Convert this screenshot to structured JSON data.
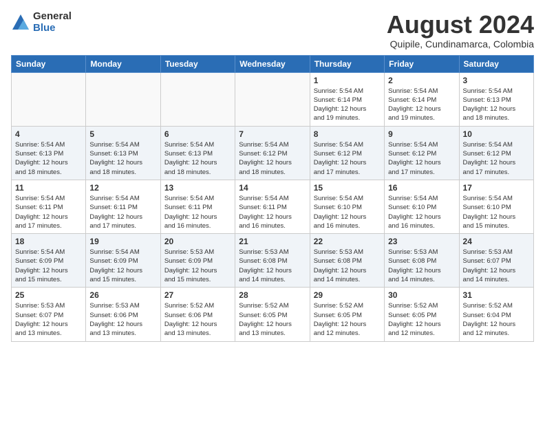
{
  "logo": {
    "general": "General",
    "blue": "Blue"
  },
  "title": "August 2024",
  "location": "Quipile, Cundinamarca, Colombia",
  "weekdays": [
    "Sunday",
    "Monday",
    "Tuesday",
    "Wednesday",
    "Thursday",
    "Friday",
    "Saturday"
  ],
  "weeks": [
    [
      {
        "day": "",
        "info": ""
      },
      {
        "day": "",
        "info": ""
      },
      {
        "day": "",
        "info": ""
      },
      {
        "day": "",
        "info": ""
      },
      {
        "day": "1",
        "info": "Sunrise: 5:54 AM\nSunset: 6:14 PM\nDaylight: 12 hours\nand 19 minutes."
      },
      {
        "day": "2",
        "info": "Sunrise: 5:54 AM\nSunset: 6:14 PM\nDaylight: 12 hours\nand 19 minutes."
      },
      {
        "day": "3",
        "info": "Sunrise: 5:54 AM\nSunset: 6:13 PM\nDaylight: 12 hours\nand 18 minutes."
      }
    ],
    [
      {
        "day": "4",
        "info": "Sunrise: 5:54 AM\nSunset: 6:13 PM\nDaylight: 12 hours\nand 18 minutes."
      },
      {
        "day": "5",
        "info": "Sunrise: 5:54 AM\nSunset: 6:13 PM\nDaylight: 12 hours\nand 18 minutes."
      },
      {
        "day": "6",
        "info": "Sunrise: 5:54 AM\nSunset: 6:13 PM\nDaylight: 12 hours\nand 18 minutes."
      },
      {
        "day": "7",
        "info": "Sunrise: 5:54 AM\nSunset: 6:12 PM\nDaylight: 12 hours\nand 18 minutes."
      },
      {
        "day": "8",
        "info": "Sunrise: 5:54 AM\nSunset: 6:12 PM\nDaylight: 12 hours\nand 17 minutes."
      },
      {
        "day": "9",
        "info": "Sunrise: 5:54 AM\nSunset: 6:12 PM\nDaylight: 12 hours\nand 17 minutes."
      },
      {
        "day": "10",
        "info": "Sunrise: 5:54 AM\nSunset: 6:12 PM\nDaylight: 12 hours\nand 17 minutes."
      }
    ],
    [
      {
        "day": "11",
        "info": "Sunrise: 5:54 AM\nSunset: 6:11 PM\nDaylight: 12 hours\nand 17 minutes."
      },
      {
        "day": "12",
        "info": "Sunrise: 5:54 AM\nSunset: 6:11 PM\nDaylight: 12 hours\nand 17 minutes."
      },
      {
        "day": "13",
        "info": "Sunrise: 5:54 AM\nSunset: 6:11 PM\nDaylight: 12 hours\nand 16 minutes."
      },
      {
        "day": "14",
        "info": "Sunrise: 5:54 AM\nSunset: 6:11 PM\nDaylight: 12 hours\nand 16 minutes."
      },
      {
        "day": "15",
        "info": "Sunrise: 5:54 AM\nSunset: 6:10 PM\nDaylight: 12 hours\nand 16 minutes."
      },
      {
        "day": "16",
        "info": "Sunrise: 5:54 AM\nSunset: 6:10 PM\nDaylight: 12 hours\nand 16 minutes."
      },
      {
        "day": "17",
        "info": "Sunrise: 5:54 AM\nSunset: 6:10 PM\nDaylight: 12 hours\nand 15 minutes."
      }
    ],
    [
      {
        "day": "18",
        "info": "Sunrise: 5:54 AM\nSunset: 6:09 PM\nDaylight: 12 hours\nand 15 minutes."
      },
      {
        "day": "19",
        "info": "Sunrise: 5:54 AM\nSunset: 6:09 PM\nDaylight: 12 hours\nand 15 minutes."
      },
      {
        "day": "20",
        "info": "Sunrise: 5:53 AM\nSunset: 6:09 PM\nDaylight: 12 hours\nand 15 minutes."
      },
      {
        "day": "21",
        "info": "Sunrise: 5:53 AM\nSunset: 6:08 PM\nDaylight: 12 hours\nand 14 minutes."
      },
      {
        "day": "22",
        "info": "Sunrise: 5:53 AM\nSunset: 6:08 PM\nDaylight: 12 hours\nand 14 minutes."
      },
      {
        "day": "23",
        "info": "Sunrise: 5:53 AM\nSunset: 6:08 PM\nDaylight: 12 hours\nand 14 minutes."
      },
      {
        "day": "24",
        "info": "Sunrise: 5:53 AM\nSunset: 6:07 PM\nDaylight: 12 hours\nand 14 minutes."
      }
    ],
    [
      {
        "day": "25",
        "info": "Sunrise: 5:53 AM\nSunset: 6:07 PM\nDaylight: 12 hours\nand 13 minutes."
      },
      {
        "day": "26",
        "info": "Sunrise: 5:53 AM\nSunset: 6:06 PM\nDaylight: 12 hours\nand 13 minutes."
      },
      {
        "day": "27",
        "info": "Sunrise: 5:52 AM\nSunset: 6:06 PM\nDaylight: 12 hours\nand 13 minutes."
      },
      {
        "day": "28",
        "info": "Sunrise: 5:52 AM\nSunset: 6:05 PM\nDaylight: 12 hours\nand 13 minutes."
      },
      {
        "day": "29",
        "info": "Sunrise: 5:52 AM\nSunset: 6:05 PM\nDaylight: 12 hours\nand 12 minutes."
      },
      {
        "day": "30",
        "info": "Sunrise: 5:52 AM\nSunset: 6:05 PM\nDaylight: 12 hours\nand 12 minutes."
      },
      {
        "day": "31",
        "info": "Sunrise: 5:52 AM\nSunset: 6:04 PM\nDaylight: 12 hours\nand 12 minutes."
      }
    ]
  ]
}
